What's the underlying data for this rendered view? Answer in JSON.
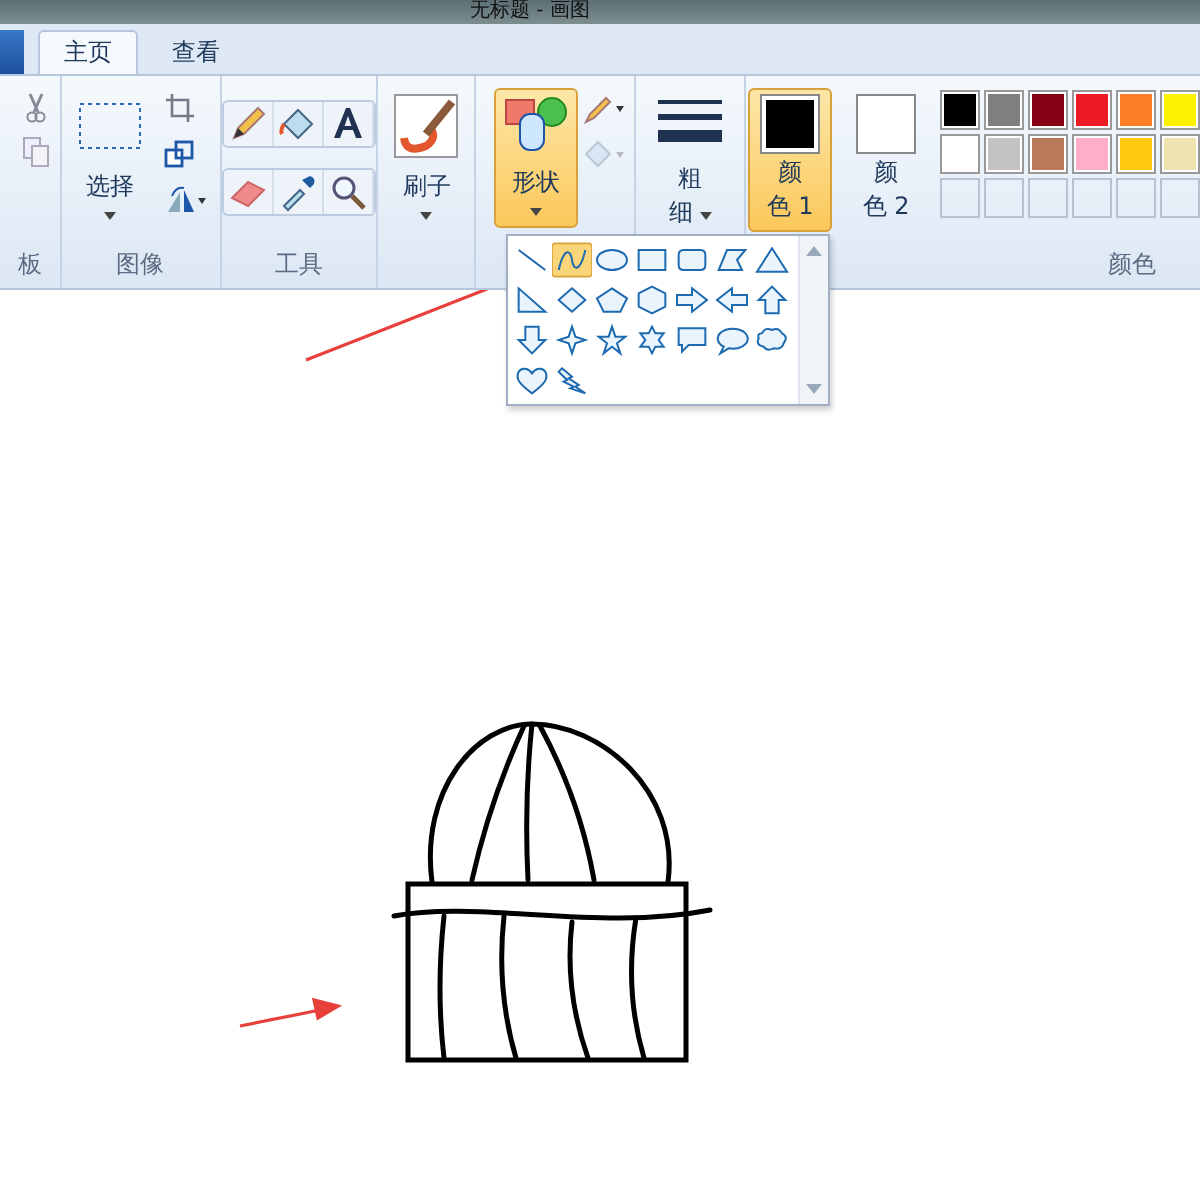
{
  "window": {
    "title": "无标题 - 画图"
  },
  "tabs": [
    {
      "label": "主页",
      "selected": true
    },
    {
      "label": "查看",
      "selected": false
    }
  ],
  "clipboard": {
    "label": "板"
  },
  "image": {
    "label": "图像",
    "select_label": "选择"
  },
  "tools": {
    "label": "工具"
  },
  "brushes": {
    "label": "刷子"
  },
  "shapes": {
    "label": "形状",
    "expanded": true,
    "items": [
      {
        "kind": "line",
        "selected": false
      },
      {
        "kind": "curve",
        "selected": true
      },
      {
        "kind": "oval",
        "selected": false
      },
      {
        "kind": "rectangle",
        "selected": false
      },
      {
        "kind": "rounded-rectangle",
        "selected": false
      },
      {
        "kind": "polygon",
        "selected": false
      },
      {
        "kind": "triangle",
        "selected": false
      },
      {
        "kind": "right-triangle",
        "selected": false
      },
      {
        "kind": "diamond",
        "selected": false
      },
      {
        "kind": "pentagon",
        "selected": false
      },
      {
        "kind": "hexagon",
        "selected": false
      },
      {
        "kind": "right-arrow",
        "selected": false
      },
      {
        "kind": "left-arrow",
        "selected": false
      },
      {
        "kind": "up-arrow",
        "selected": false
      },
      {
        "kind": "down-arrow",
        "selected": false
      },
      {
        "kind": "star4",
        "selected": false
      },
      {
        "kind": "star5",
        "selected": false
      },
      {
        "kind": "star6",
        "selected": false
      },
      {
        "kind": "rect-callout",
        "selected": false
      },
      {
        "kind": "oval-callout",
        "selected": false
      },
      {
        "kind": "cloud-callout",
        "selected": false
      },
      {
        "kind": "heart",
        "selected": false
      },
      {
        "kind": "lightning",
        "selected": false
      }
    ]
  },
  "size": {
    "line1": "粗",
    "line2": "细"
  },
  "color1": {
    "line1": "颜",
    "line2": "色 1",
    "selected": true,
    "color": "#000000"
  },
  "color2": {
    "line1": "颜",
    "line2": "色 2",
    "selected": false,
    "color": "#ffffff"
  },
  "colors": {
    "label": "颜色",
    "palette": [
      {
        "color": "#000000"
      },
      {
        "color": "#7f7f7f"
      },
      {
        "color": "#880015"
      },
      {
        "color": "#ed1c24"
      },
      {
        "color": "#ff7f27"
      },
      {
        "color": "#fff200"
      },
      {
        "color": "#ffffff"
      },
      {
        "color": "#c3c3c3"
      },
      {
        "color": "#b97a57"
      },
      {
        "color": "#ffaec9"
      },
      {
        "color": "#ffc90e"
      },
      {
        "color": "#efe4b0"
      }
    ]
  }
}
